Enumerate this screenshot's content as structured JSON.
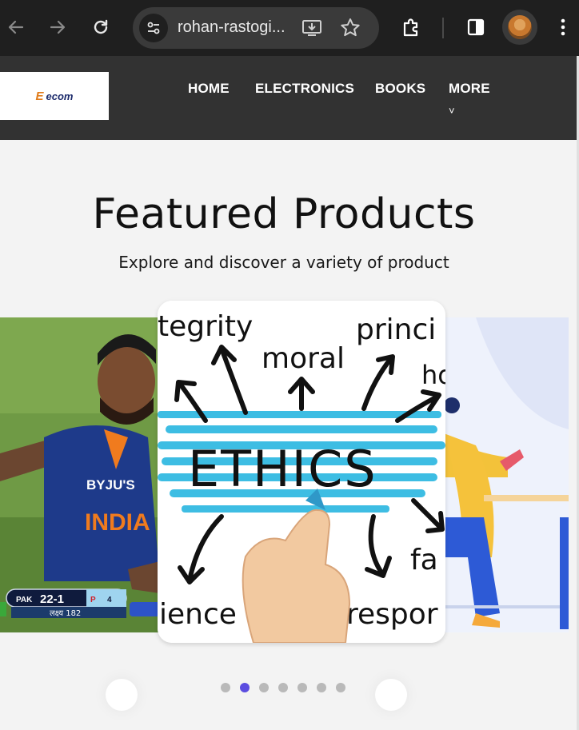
{
  "browser": {
    "url": "rohan-rastogi...",
    "icons": [
      "back-icon",
      "forward-icon",
      "reload-icon",
      "site-settings-icon",
      "install-app-icon",
      "bookmark-star-icon",
      "extensions-icon",
      "side-panel-icon",
      "profile-avatar",
      "menu-icon"
    ]
  },
  "header": {
    "logo_text": "ecom",
    "nav": [
      "HOME",
      "ELECTRONICS",
      "BOOKS",
      "MORE"
    ],
    "more_caret": "˅"
  },
  "hero": {
    "title": "Featured Products",
    "subtitle": "Explore and discover a variety of product"
  },
  "carousel": {
    "left_slide": {
      "jersey_brand": "BYJU'S",
      "jersey_team": "INDIA",
      "score_team": "PAK",
      "score": "22-1",
      "score_badge": "P",
      "score_overs": "4",
      "target_line": "लक्ष्य 182"
    },
    "center_slide": {
      "main_word": "ETHICS",
      "words": [
        "tegrity",
        "moral",
        "princi",
        "ho",
        "fa",
        "ience",
        "respor"
      ]
    },
    "dot_count": 7,
    "active_dot": 1
  },
  "colors": {
    "navbar": "#323232",
    "page_bg": "#f3f3f3",
    "active_dot": "#5b4de0",
    "inactive_dot": "#b9b9b9",
    "ethics_highlight": "#29b6e0"
  }
}
